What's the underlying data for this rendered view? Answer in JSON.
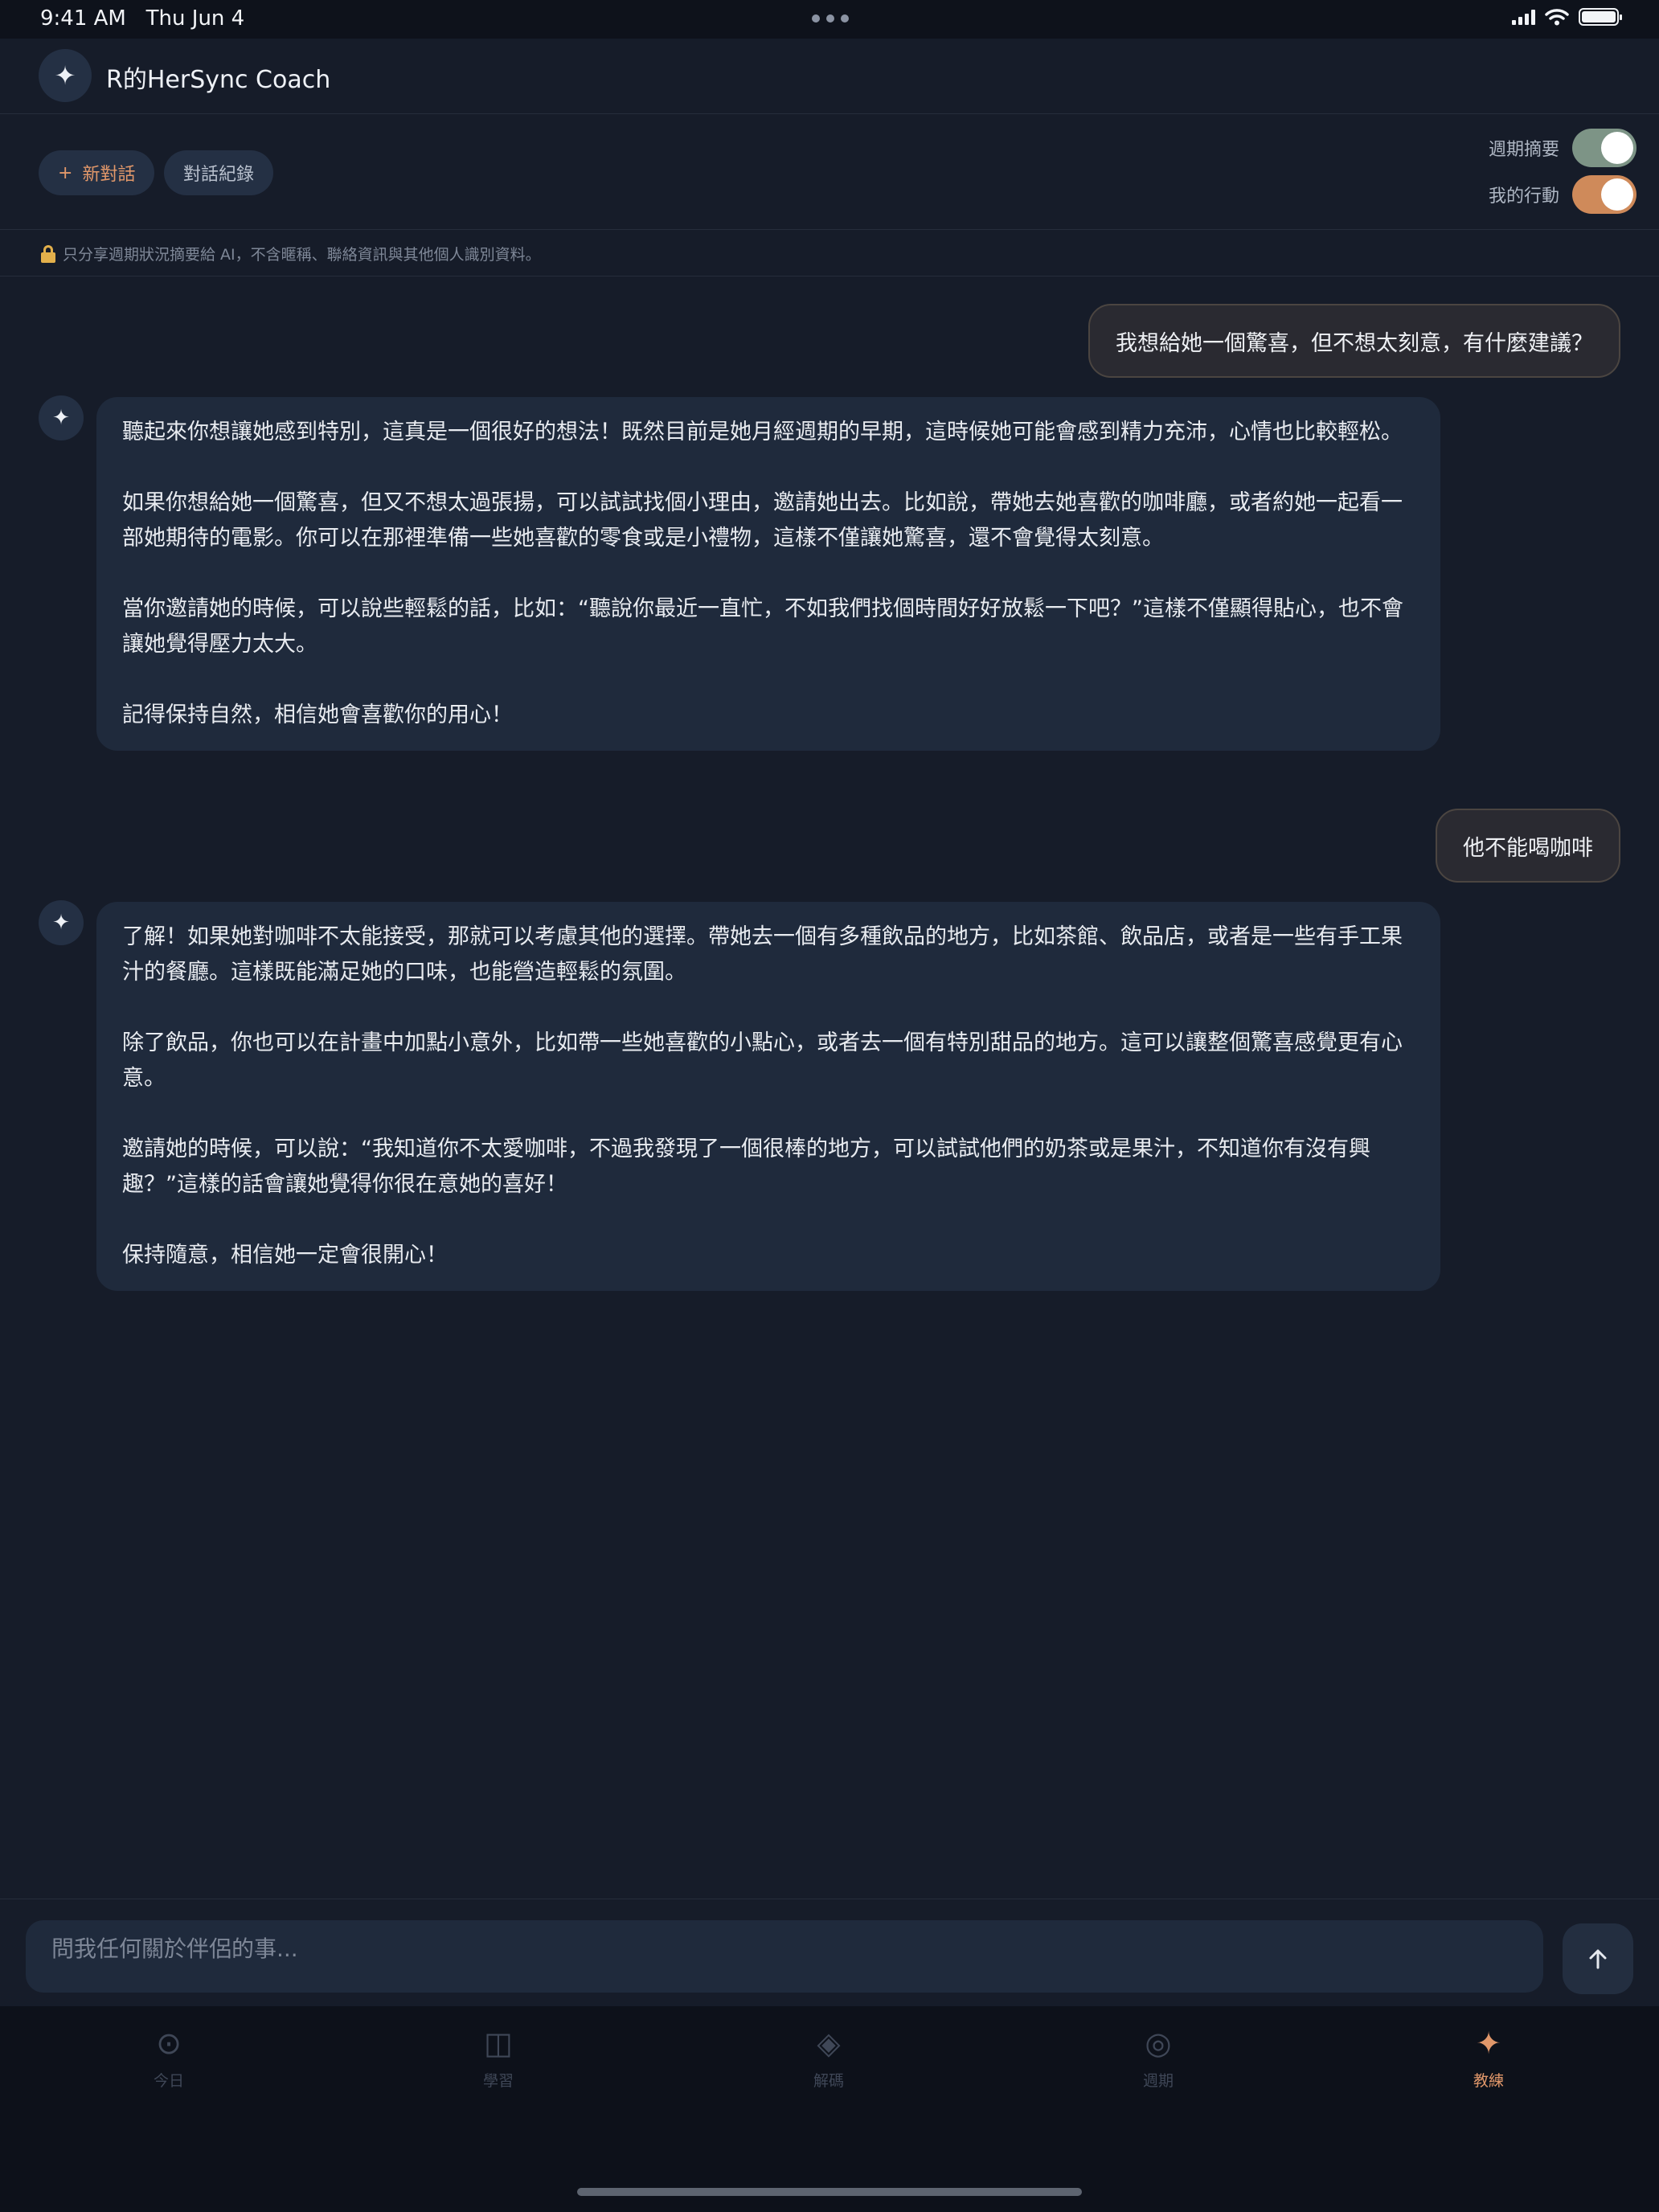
{
  "status_bar": {
    "time": "9:41 AM",
    "date": "Thu Jun 4"
  },
  "header": {
    "avatar_icon": "sparkle-icon",
    "title": "R的HerSync Coach"
  },
  "toolbar": {
    "new_chat_icon": "plus-icon",
    "new_chat_label": "新對話",
    "history_label": "對話紀錄",
    "toggles": [
      {
        "label": "週期摘要",
        "on": true,
        "color": "#7d9486"
      },
      {
        "label": "我的行動",
        "on": true,
        "color": "#cf8a5a"
      }
    ]
  },
  "privacy": {
    "icon": "lock-icon",
    "text": "只分享週期狀況摘要給 AI，不含暱稱、聯絡資訊與其他個人識別資料。"
  },
  "messages": [
    {
      "role": "user",
      "text": "我想給她一個驚喜，但不想太刻意，有什麼建議？"
    },
    {
      "role": "assistant",
      "paragraphs": [
        "聽起來你想讓她感到特別，這真是一個很好的想法！既然目前是她月經週期的早期，這時候她可能會感到精力充沛，心情也比較輕松。",
        "如果你想給她一個驚喜，但又不想太過張揚，可以試試找個小理由，邀請她出去。比如說，帶她去她喜歡的咖啡廳，或者約她一起看一部她期待的電影。你可以在那裡準備一些她喜歡的零食或是小禮物，這樣不僅讓她驚喜，還不會覺得太刻意。",
        "當你邀請她的時候，可以說些輕鬆的話，比如：“聽說你最近一直忙，不如我們找個時間好好放鬆一下吧？”這樣不僅顯得貼心，也不會讓她覺得壓力太大。",
        "記得保持自然，相信她會喜歡你的用心！"
      ]
    },
    {
      "role": "user",
      "text": "他不能喝咖啡"
    },
    {
      "role": "assistant",
      "paragraphs": [
        "了解！如果她對咖啡不太能接受，那就可以考慮其他的選擇。帶她去一個有多種飲品的地方，比如茶館、飲品店，或者是一些有手工果汁的餐廳。這樣既能滿足她的口味，也能營造輕鬆的氛圍。",
        "除了飲品，你也可以在計畫中加點小意外，比如帶一些她喜歡的小點心，或者去一個有特別甜品的地方。這可以讓整個驚喜感覺更有心意。",
        "邀請她的時候，可以說：“我知道你不太愛咖啡，不過我發現了一個很棒的地方，可以試試他們的奶茶或是果汁，不知道你有沒有興趣？”這樣的話會讓她覺得你很在意她的喜好！",
        "保持隨意，相信她一定會很開心！"
      ]
    }
  ],
  "composer": {
    "placeholder": "問我任何關於伴侶的事...",
    "send_icon": "arrow-up-icon"
  },
  "tabs": [
    {
      "label": "今日",
      "icon": "sun-circle-icon",
      "glyph": "⊙",
      "active": false
    },
    {
      "label": "學習",
      "icon": "book-icon",
      "glyph": "◫",
      "active": false
    },
    {
      "label": "解碼",
      "icon": "diamond-icon",
      "glyph": "◈",
      "active": false
    },
    {
      "label": "週期",
      "icon": "cycle-ring-icon",
      "glyph": "◎",
      "active": false
    },
    {
      "label": "教練",
      "icon": "sparkle-icon",
      "glyph": "✦",
      "active": true
    }
  ],
  "colors": {
    "background": "#161c29",
    "accent": "#e0976a",
    "bubble_assistant": "#1f2a3c",
    "bubble_user": "#2a2a31"
  }
}
